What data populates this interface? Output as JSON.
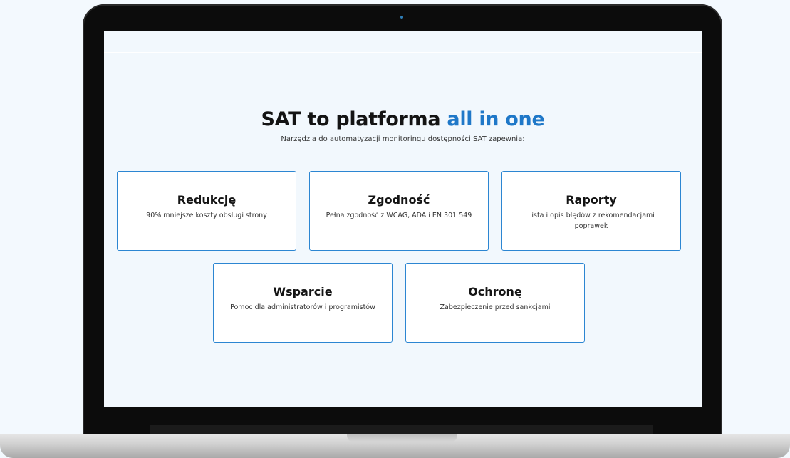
{
  "headline": {
    "main": "SAT to platforma",
    "accent": "all in one",
    "accent_color": "#1f78c8"
  },
  "subline": "Narzędzia do automatyzacji monitoringu dostępności SAT zapewnia:",
  "cards": [
    {
      "title": "Redukcję",
      "desc": "90% mniejsze koszty obsługi strony"
    },
    {
      "title": "Zgodność",
      "desc": "Pełna zgodność z WCAG, ADA i EN 301 549"
    },
    {
      "title": "Raporty",
      "desc": "Lista i opis błędów z rekomendacjami poprawek"
    },
    {
      "title": "Wsparcie",
      "desc": "Pomoc dla administratorów i programistów"
    },
    {
      "title": "Ochronę",
      "desc": "Zabezpieczenie przed sankcjami"
    }
  ],
  "colors": {
    "card_border": "#2c86d2",
    "screen_background": "#f2f8fd",
    "bezel": "#0c0c0c"
  }
}
